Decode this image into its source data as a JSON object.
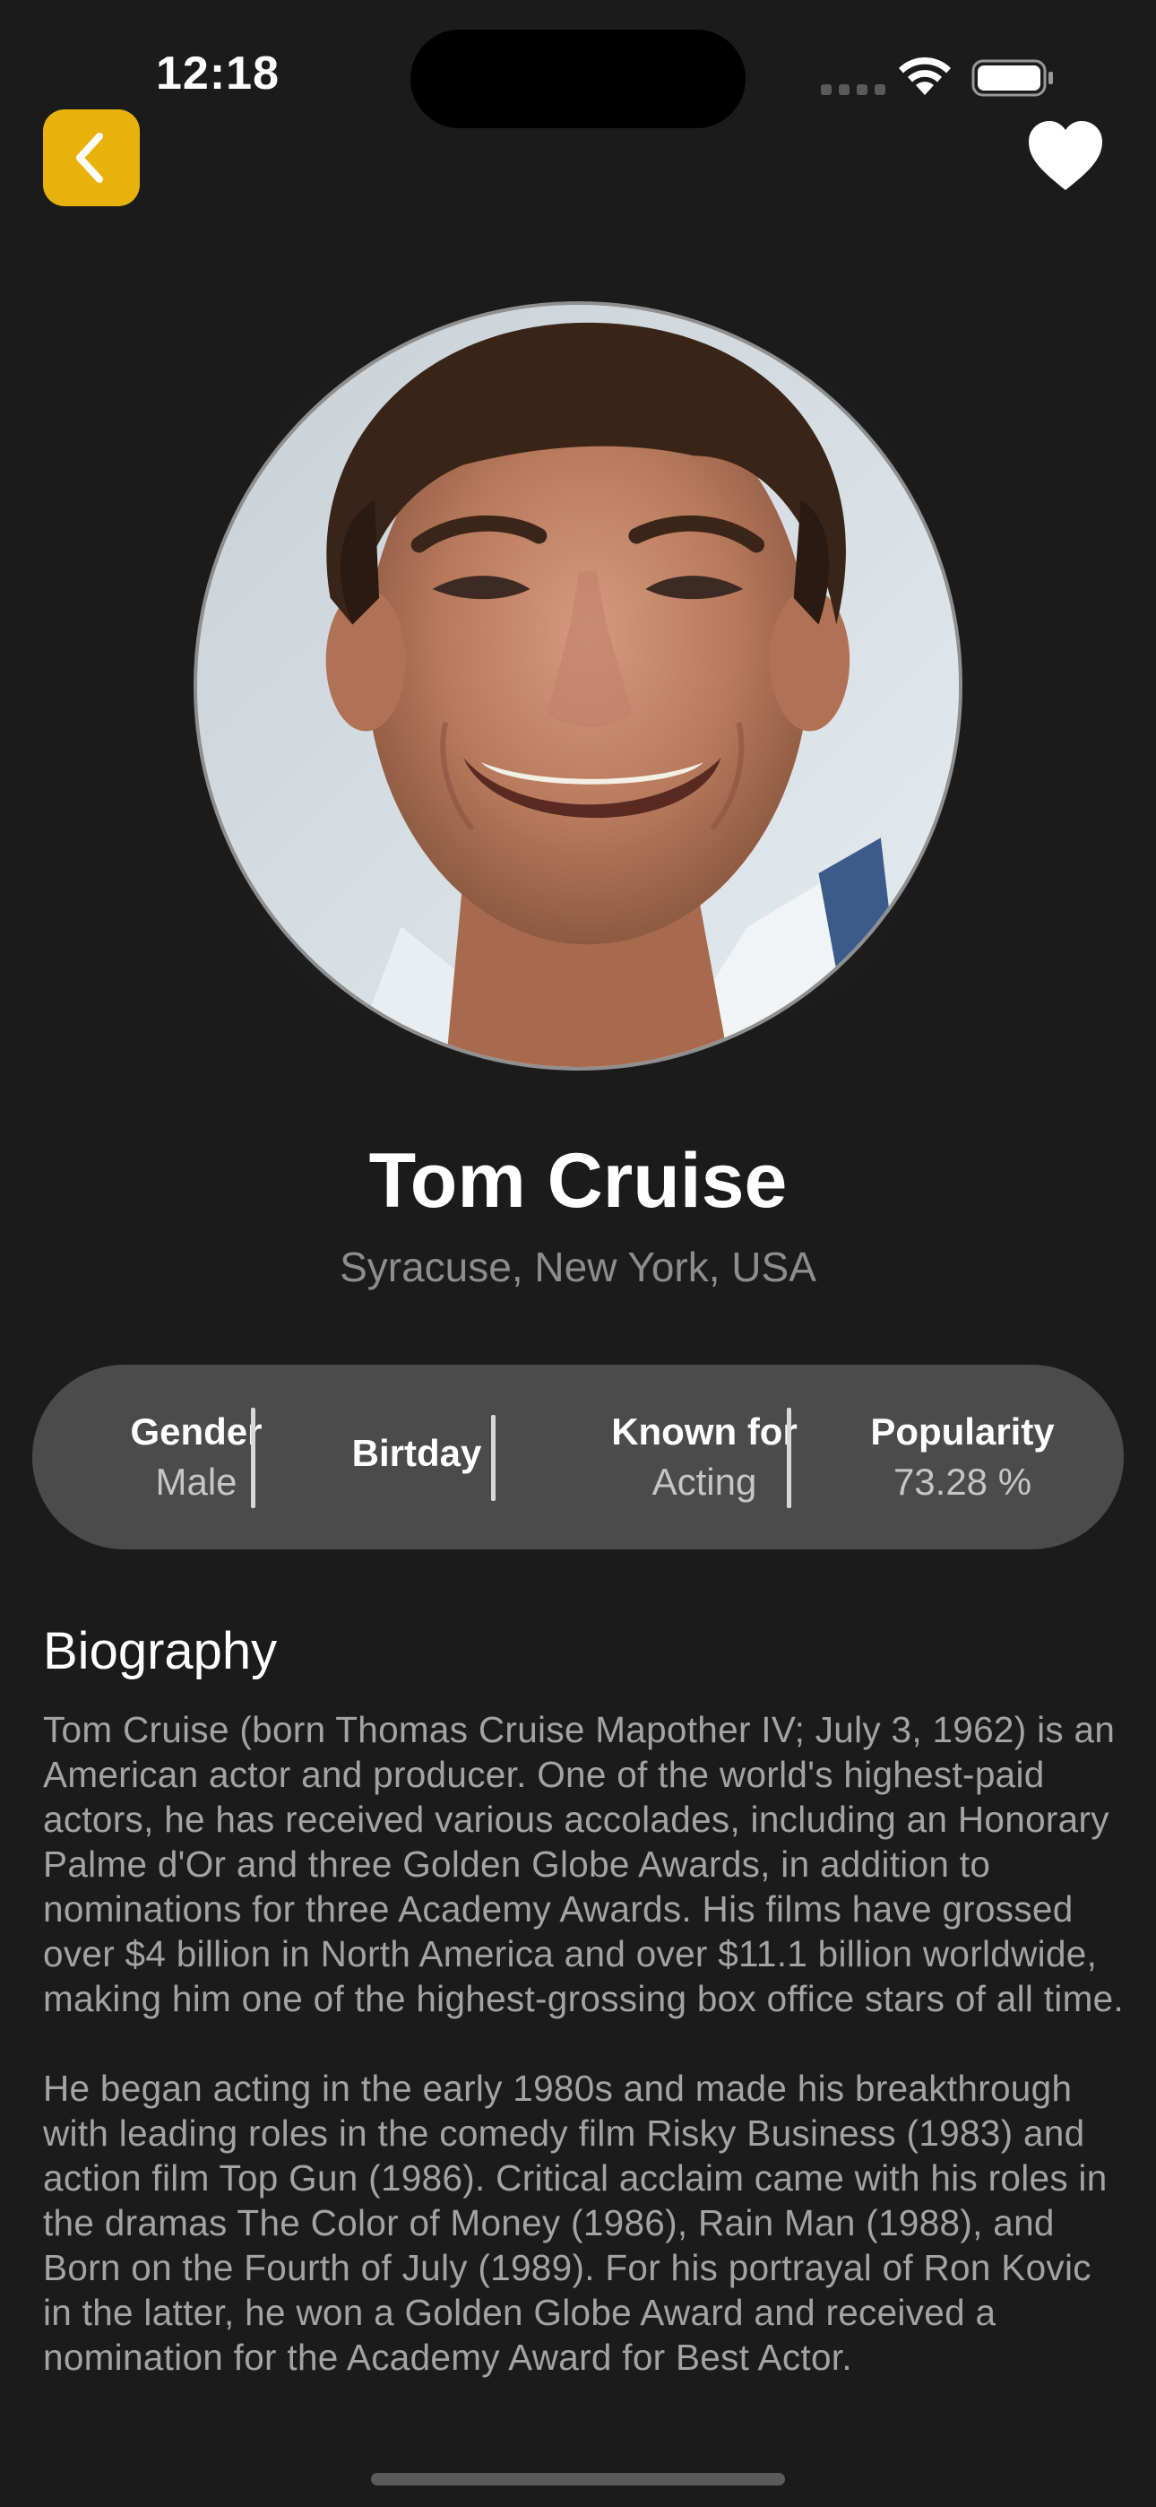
{
  "status_bar": {
    "time": "12:18",
    "icons": [
      "cellular-signal-icon",
      "wifi-icon",
      "battery-icon"
    ]
  },
  "nav": {
    "back_icon": "chevron-left-icon",
    "favorite_icon": "heart-icon"
  },
  "colors": {
    "background": "#1b1b1b",
    "accent": "#e8b10c",
    "info_bar": "#4b4b4b",
    "secondary_text": "#8d8d8d"
  },
  "person": {
    "name": "Tom Cruise",
    "birthplace": "Syracuse, New York, USA"
  },
  "info": {
    "gender": {
      "label": "Gender",
      "value": "Male"
    },
    "birthday": {
      "label": "Birtday",
      "value": ""
    },
    "known_for": {
      "label": "Known for",
      "value": "Acting"
    },
    "popularity": {
      "label": "Popularity",
      "value": "73.28 %"
    }
  },
  "biography": {
    "title": "Biography",
    "paragraphs": [
      "Tom Cruise (born Thomas Cruise Mapother IV; July 3, 1962) is an American actor and producer. One of the world's highest-paid actors, he has received various accolades, including an Honorary Palme d'Or and three Golden Globe Awards, in addition to nominations for three Academy Awards. His films have grossed over $4 billion in North America and over $11.1 billion worldwide, making him one of the highest-grossing box office stars of all time.",
      "He began acting in the early 1980s and made his breakthrough with leading roles in the comedy film Risky Business (1983) and action film Top Gun (1986). Critical acclaim came with his roles in the dramas The Color of Money (1986), Rain Man (1988), and Born on the Fourth of July (1989). For his portrayal of Ron Kovic in the latter, he won a Golden Globe Award and received a nomination for the Academy Award for Best Actor."
    ]
  }
}
